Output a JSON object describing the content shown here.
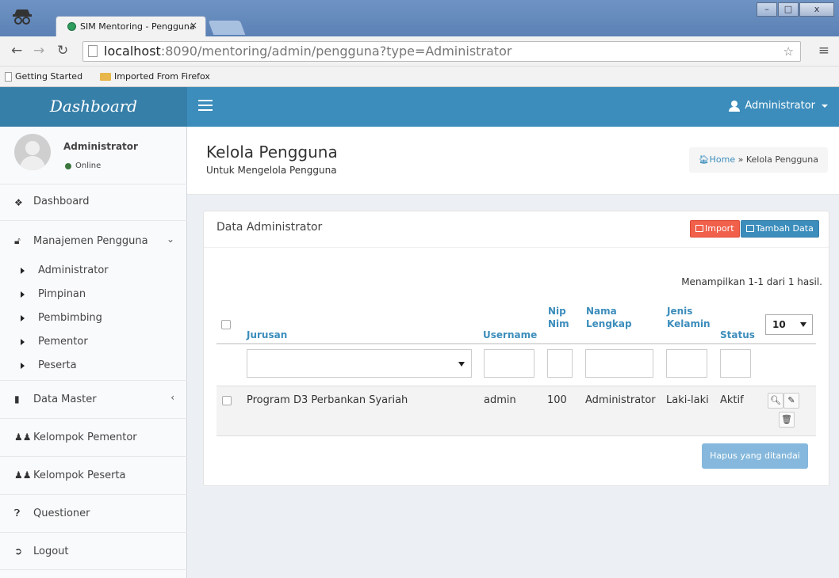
{
  "browser": {
    "tab_title": "SIM Mentoring - Pengguna",
    "tab_close": "×",
    "url_host": "localhost",
    "url_rest": ":8090/mentoring/admin/pengguna?type=Administrator",
    "bookmarks": [
      "Getting Started",
      "Imported From Firefox"
    ],
    "window_buttons": [
      "–",
      "□",
      "x"
    ]
  },
  "app": {
    "logo": "Dashboard",
    "user_menu": "Administrator"
  },
  "sidebar": {
    "user_name": "Administrator",
    "user_status": "Online",
    "items": [
      {
        "label": "Dashboard",
        "icon": "home-icon"
      },
      {
        "label": "Manajemen Pengguna",
        "icon": "unlock-icon"
      },
      {
        "label": "Data Master",
        "icon": "book-icon"
      },
      {
        "label": "Kelompok Pementor",
        "icon": "users-icon"
      },
      {
        "label": "Kelompok Peserta",
        "icon": "users-icon"
      },
      {
        "label": "Questioner",
        "icon": "question-circle-icon"
      },
      {
        "label": "Logout",
        "icon": "sign-out-icon"
      }
    ],
    "subitems": [
      "Administrator",
      "Pimpinan",
      "Pembimbing",
      "Pementor",
      "Peserta"
    ]
  },
  "header": {
    "title": "Kelola Pengguna",
    "subtitle": "Untuk Mengelola Pengguna",
    "breadcrumb_home": "Home",
    "breadcrumb_sep": "»",
    "breadcrumb_current": "Kelola Pengguna"
  },
  "box": {
    "title": "Data Administrator",
    "import_label": "Import",
    "add_label": "Tambah Data",
    "summary": "Menampilkan 1-1 dari 1 hasil.",
    "page_size": "10",
    "delete_marked_label": "Hapus yang ditandai"
  },
  "table": {
    "headers": {
      "jurusan": "Jurusan",
      "username": "Username",
      "nip_nim": [
        "Nip",
        "Nim"
      ],
      "nama_lengkap": [
        "Nama",
        "Lengkap"
      ],
      "jenis_kelamin": [
        "Jenis",
        "Kelamin"
      ],
      "status": "Status"
    },
    "rows": [
      {
        "jurusan": "Program D3 Perbankan Syariah",
        "username": "admin",
        "nip_nim": "100",
        "nama_lengkap": "Administrator",
        "jenis_kelamin": "Laki-laki",
        "status": "Aktif"
      }
    ]
  },
  "colors": {
    "navbar": "#3c8dbc",
    "logo_bg": "#367fa9",
    "import_button": "#f0604b",
    "add_button": "#3c8dbc",
    "online_dot": "#3c763d",
    "delete_button": "#85b8dc"
  }
}
